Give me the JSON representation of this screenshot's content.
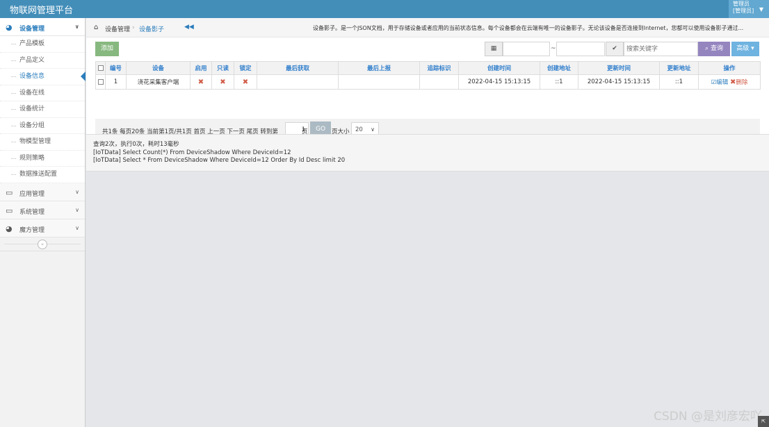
{
  "app": {
    "title": "物联网管理平台"
  },
  "user": {
    "line1": "管理员",
    "line2": "[管理员]"
  },
  "sidebar": {
    "active_group": {
      "label": "设备管理",
      "icon": "dashboard-icon"
    },
    "sub_items": [
      "产品模板",
      "产品定义",
      "设备信息",
      "设备在线",
      "设备统计",
      "设备分组",
      "物模型管理",
      "规则策略",
      "数据推送配置"
    ],
    "active_index": 2,
    "groups": [
      {
        "label": "应用管理",
        "icon": "desktop-icon"
      },
      {
        "label": "系统管理",
        "icon": "desktop-icon"
      },
      {
        "label": "魔方管理",
        "icon": "dashboard-icon"
      }
    ]
  },
  "breadcrumb": {
    "item1": "设备管理",
    "item2": "设备影子"
  },
  "description": "设备影子。是一个JSON文档，用于存储设备或者应用的当前状态信息。每个设备都会在云端有唯一的设备影子。无论该设备是否连接到Internet，您都可以使用设备影子通过...",
  "toolbar": {
    "add_label": "添加",
    "date_separator": "~",
    "search_placeholder": "搜索关键字",
    "query_label": "查询",
    "advanced_label": "高级"
  },
  "table": {
    "headers": [
      "编号",
      "设备",
      "启用",
      "只读",
      "锁定",
      "最后获取",
      "最后上报",
      "追踪标识",
      "创建时间",
      "创建地址",
      "更新时间",
      "更新地址",
      "操作"
    ],
    "rows": [
      {
        "id": "1",
        "device": "浇花采集客户端",
        "enabled": "✖",
        "readonly": "✖",
        "locked": "✖",
        "last_get": "",
        "last_report": "",
        "trace": "",
        "created_time": "2022-04-15 15:13:15",
        "created_addr": "::1",
        "updated_time": "2022-04-15 15:13:15",
        "updated_addr": "::1",
        "edit": "编辑",
        "delete": "删除"
      }
    ]
  },
  "pager": {
    "summary": "共1条  每页20条  当前第1页/共1页  首页  上一页  下一页  尾页  转到第",
    "page_value": "1",
    "page_unit": "页",
    "go_label": "GO",
    "size_label": "页大小",
    "size_value": "20"
  },
  "log": {
    "lines": [
      "查询2次，执行0次，耗时13毫秒",
      "[IoTData] Select Count(*) From DeviceShadow Where DeviceId=12",
      "[IoTData] Select * From DeviceShadow Where DeviceId=12 Order By Id Desc limit 20"
    ]
  },
  "watermark": "CSDN @是刘彦宏吖"
}
